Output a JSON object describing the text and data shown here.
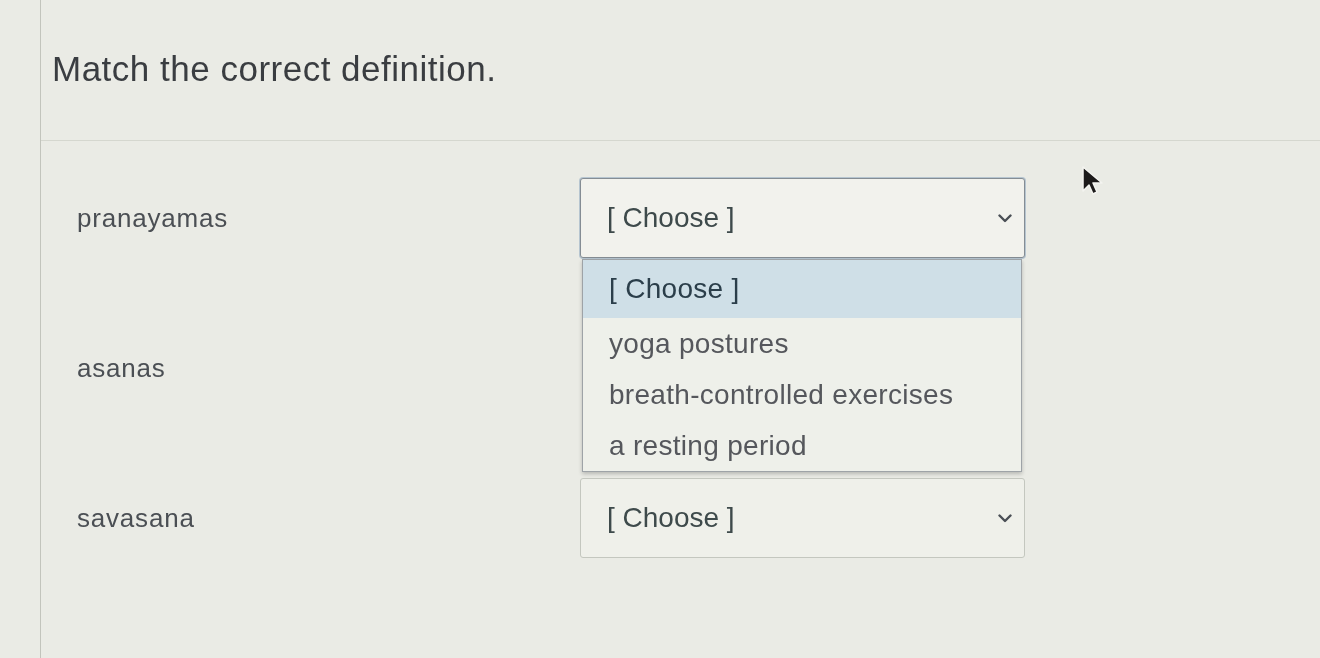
{
  "title": "Match the correct definition.",
  "rows": [
    {
      "term": "pranayamas",
      "select": {
        "value": "[ Choose ]",
        "expanded": true,
        "options": [
          {
            "label": "[ Choose ]",
            "selected": true
          },
          {
            "label": "yoga postures",
            "selected": false
          },
          {
            "label": "breath-controlled exercises",
            "selected": false
          },
          {
            "label": "a resting period",
            "selected": false
          }
        ]
      }
    },
    {
      "term": "asanas"
    },
    {
      "term": "savasana",
      "select": {
        "value": "[ Choose ]",
        "expanded": false
      }
    }
  ]
}
